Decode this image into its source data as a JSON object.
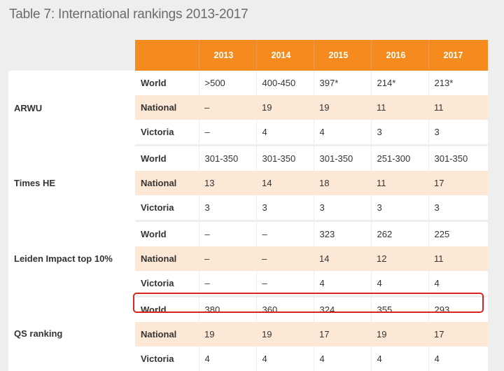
{
  "title": "Table 7: International rankings 2013-2017",
  "years": [
    "2013",
    "2014",
    "2015",
    "2016",
    "2017"
  ],
  "groups": [
    {
      "name": "ARWU",
      "rows": [
        {
          "label": "World",
          "values": [
            ">500",
            "400-450",
            "397*",
            "214*",
            "213*"
          ]
        },
        {
          "label": "National",
          "values": [
            "–",
            "19",
            "19",
            "11",
            "11"
          ]
        },
        {
          "label": "Victoria",
          "values": [
            "–",
            "4",
            "4",
            "3",
            "3"
          ]
        }
      ]
    },
    {
      "name": "Times HE",
      "rows": [
        {
          "label": "World",
          "values": [
            "301-350",
            "301-350",
            "301-350",
            "251-300",
            "301-350"
          ]
        },
        {
          "label": "National",
          "values": [
            "13",
            "14",
            "18",
            "11",
            "17"
          ]
        },
        {
          "label": "Victoria",
          "values": [
            "3",
            "3",
            "3",
            "3",
            "3"
          ]
        }
      ]
    },
    {
      "name": "Leiden Impact top 10%",
      "rows": [
        {
          "label": "World",
          "values": [
            "–",
            "–",
            "323",
            "262",
            "225"
          ]
        },
        {
          "label": "National",
          "values": [
            "–",
            "–",
            "14",
            "12",
            "11"
          ]
        },
        {
          "label": "Victoria",
          "values": [
            "–",
            "–",
            "4",
            "4",
            "4"
          ]
        }
      ]
    },
    {
      "name": "QS ranking",
      "rows": [
        {
          "label": "World",
          "values": [
            "380",
            "360",
            "324",
            "355",
            "293"
          ]
        },
        {
          "label": "National",
          "values": [
            "19",
            "19",
            "17",
            "19",
            "17"
          ]
        },
        {
          "label": "Victoria",
          "values": [
            "4",
            "4",
            "4",
            "4",
            "4"
          ]
        }
      ]
    }
  ],
  "colors": {
    "header": "#f58a1f",
    "institution_text": "#f07c1c",
    "band": "#fde8d5",
    "highlight": "#d9231f"
  }
}
